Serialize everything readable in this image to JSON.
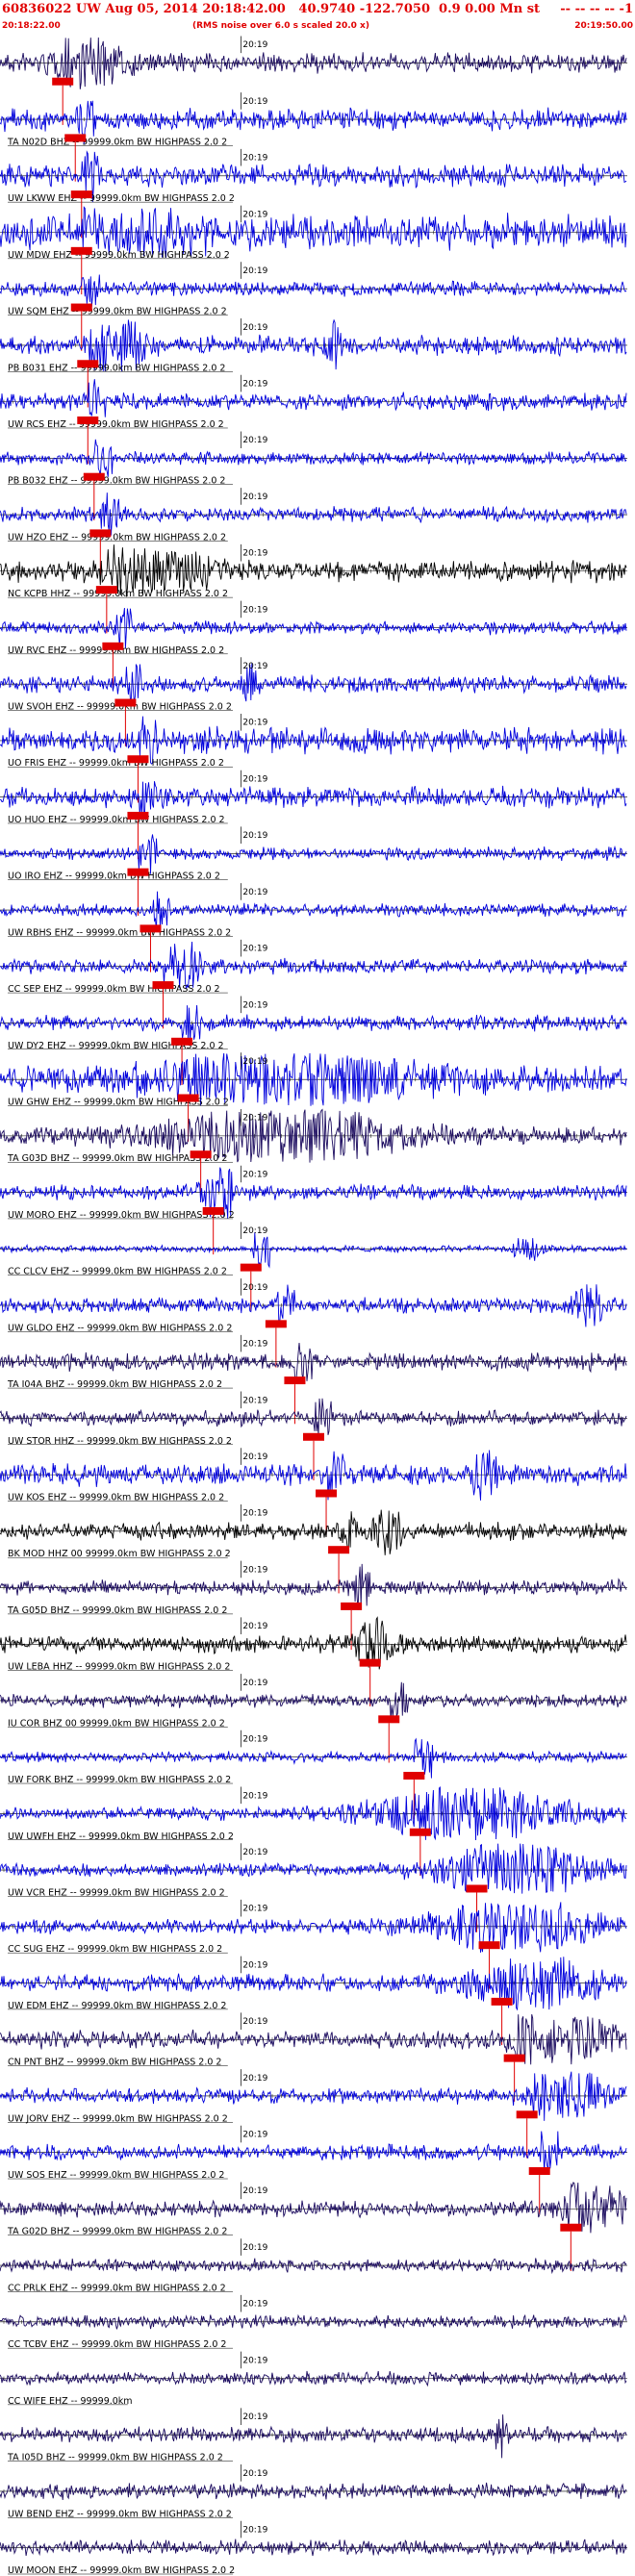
{
  "header": {
    "title": "60836022 UW Aug 05, 2014 20:18:42.00   40.9740 -122.7050  0.9 0.00 Mn st",
    "right_marker": "-- -- -- -- -1",
    "start_time": "20:18:22.00",
    "note": "(RMS noise over 6.0 s scaled 20.0 x)",
    "end_time": "20:19:50.00"
  },
  "chart_data": {
    "type": "seismogram",
    "time_window": [
      "20:18:22.00",
      "20:19:50.00"
    ],
    "minute_tick_label": "20:19",
    "traces": [
      {
        "label": "",
        "color": "#1a0a5e",
        "amp": 0.45,
        "pick": 0.1,
        "events": [
          [
            0.14,
            0.9,
            0.05
          ]
        ]
      },
      {
        "label": "TA N02D BHZ -- 99999.0km BW  HIGHPASS  2.0  2",
        "color": "#0000dd",
        "amp": 0.5,
        "pick": 0.12,
        "events": []
      },
      {
        "label": "UW LKWW EHZ -- 99999.0km BW  HIGHPASS  2.0  2",
        "color": "#0000dd",
        "amp": 0.5,
        "pick": 0.13,
        "events": []
      },
      {
        "label": "UW MDW EHZ -- 99999.0km BW  HIGHPASS  2.0  2",
        "color": "#0000dd",
        "amp": 0.8,
        "pick": 0.13,
        "events": [
          [
            0.25,
            1.0,
            0.06
          ]
        ]
      },
      {
        "label": "UW SQM EHZ -- 99999.0km BW  HIGHPASS  2.0  2",
        "color": "#0000dd",
        "amp": 0.35,
        "pick": 0.13,
        "events": []
      },
      {
        "label": "PB B031 EHZ -- 99999.0km BW  HIGHPASS  2.0  2",
        "color": "#0000dd",
        "amp": 0.45,
        "pick": 0.14,
        "events": [
          [
            0.2,
            1.0,
            0.03
          ],
          [
            0.53,
            0.9,
            0.01
          ]
        ]
      },
      {
        "label": "UW RCS EHZ -- 99999.0km BW  HIGHPASS  2.0  2",
        "color": "#0000dd",
        "amp": 0.4,
        "pick": 0.14,
        "events": []
      },
      {
        "label": "PB B032 EHZ -- 99999.0km BW  HIGHPASS  2.0  2",
        "color": "#0000dd",
        "amp": 0.3,
        "pick": 0.15,
        "events": []
      },
      {
        "label": "UW HZO EHZ -- 99999.0km BW  HIGHPASS  2.0  2",
        "color": "#0000dd",
        "amp": 0.35,
        "pick": 0.16,
        "events": []
      },
      {
        "label": "NC KCPB HHZ -- 99999.0km BW  HIGHPASS  2.0  2",
        "color": "#000000",
        "amp": 0.5,
        "pick": 0.17,
        "events": [
          [
            0.25,
            0.8,
            0.08
          ]
        ]
      },
      {
        "label": "UW RVC EHZ -- 99999.0km BW  HIGHPASS  2.0  2",
        "color": "#0000dd",
        "amp": 0.3,
        "pick": 0.18,
        "events": []
      },
      {
        "label": "UW SVOH EHZ -- 99999.0km BW  HIGHPASS  2.0  2",
        "color": "#0000dd",
        "amp": 0.4,
        "pick": 0.2,
        "events": [
          [
            0.4,
            0.8,
            0.01
          ]
        ]
      },
      {
        "label": "UO FRIS EHZ -- 99999.0km BW  HIGHPASS  2.0  2",
        "color": "#0000dd",
        "amp": 0.6,
        "pick": 0.22,
        "events": []
      },
      {
        "label": "UO HUO EHZ -- 99999.0km BW  HIGHPASS  2.0  2",
        "color": "#0000dd",
        "amp": 0.5,
        "pick": 0.22,
        "events": []
      },
      {
        "label": "UO IRO EHZ -- 99999.0km BW  HIGHPASS  2.0  2",
        "color": "#0000dd",
        "amp": 0.3,
        "pick": 0.22,
        "events": []
      },
      {
        "label": "UW RBHS EHZ -- 99999.0km BW  HIGHPASS  2.0  2",
        "color": "#0000dd",
        "amp": 0.3,
        "pick": 0.24,
        "events": []
      },
      {
        "label": "CC SEP EHZ -- 99999.0km BW  HIGHPASS  2.0  2",
        "color": "#0000dd",
        "amp": 0.35,
        "pick": 0.26,
        "events": [
          [
            0.3,
            0.7,
            0.02
          ]
        ]
      },
      {
        "label": "UW DY2 EHZ -- 99999.0km BW  HIGHPASS  2.0  2",
        "color": "#0000dd",
        "amp": 0.35,
        "pick": 0.29,
        "events": []
      },
      {
        "label": "UW GHW EHZ -- 99999.0km BW  HIGHPASS  2.0  2",
        "color": "#0000dd",
        "amp": 0.6,
        "pick": 0.3,
        "events": [
          [
            0.45,
            1.0,
            0.2
          ]
        ]
      },
      {
        "label": "TA G03D BHZ -- 99999.0km BW  HIGHPASS  2.0  2",
        "color": "#1a0a5e",
        "amp": 0.4,
        "pick": 0.32,
        "events": [
          [
            0.45,
            1.0,
            0.18
          ]
        ]
      },
      {
        "label": "UW MORO EHZ -- 99999.0km BW  HIGHPASS  2.0  2",
        "color": "#0000dd",
        "amp": 0.35,
        "pick": 0.34,
        "events": [
          [
            0.34,
            0.9,
            0.02
          ]
        ]
      },
      {
        "label": "CC CLCV EHZ -- 99999.0km BW  HIGHPASS  2.0  2",
        "color": "#0000dd",
        "amp": 0.15,
        "pick": 0.4,
        "events": [
          [
            0.84,
            0.6,
            0.02
          ]
        ]
      },
      {
        "label": "UW GLDO EHZ -- 99999.0km BW  HIGHPASS  2.0  2",
        "color": "#0000dd",
        "amp": 0.35,
        "pick": 0.44,
        "events": [
          [
            0.94,
            1.0,
            0.02
          ]
        ]
      },
      {
        "label": "TA I04A BHZ -- 99999.0km BW  HIGHPASS  2.0  2",
        "color": "#1a0a5e",
        "amp": 0.4,
        "pick": 0.47,
        "events": []
      },
      {
        "label": "UW STOR HHZ -- 99999.0km BW  HIGHPASS  2.0  2",
        "color": "#1a0a5e",
        "amp": 0.35,
        "pick": 0.5,
        "events": []
      },
      {
        "label": "UW KOS EHZ -- 99999.0km BW  HIGHPASS  2.0  2",
        "color": "#0000dd",
        "amp": 0.5,
        "pick": 0.52,
        "events": [
          [
            0.77,
            0.9,
            0.02
          ]
        ]
      },
      {
        "label": "BK MOD HHZ 00 99999.0km BW  HIGHPASS  2.0  2",
        "color": "#000000",
        "amp": 0.4,
        "pick": 0.54,
        "events": [
          [
            0.62,
            1.0,
            0.02
          ]
        ]
      },
      {
        "label": "TA G05D BHZ -- 99999.0km BW  HIGHPASS  2.0  2",
        "color": "#1a0a5e",
        "amp": 0.35,
        "pick": 0.56,
        "events": []
      },
      {
        "label": "UW LEBA HHZ -- 99999.0km BW  HIGHPASS  2.0  2",
        "color": "#000000",
        "amp": 0.4,
        "pick": 0.59,
        "events": [
          [
            0.6,
            0.8,
            0.03
          ]
        ]
      },
      {
        "label": "IU COR BHZ 00 99999.0km BW  HIGHPASS  2.0  2",
        "color": "#1a0a5e",
        "amp": 0.3,
        "pick": 0.62,
        "events": []
      },
      {
        "label": "UW FORK BHZ -- 99999.0km BW  HIGHPASS  2.0  2",
        "color": "#0000dd",
        "amp": 0.25,
        "pick": 0.66,
        "events": []
      },
      {
        "label": "UW UWFH EHZ -- 99999.0km BW  HIGHPASS  2.0  2",
        "color": "#0000dd",
        "amp": 0.3,
        "pick": 0.67,
        "events": [
          [
            0.75,
            1.0,
            0.15
          ]
        ]
      },
      {
        "label": "UW VCR EHZ -- 99999.0km BW  HIGHPASS  2.0  2",
        "color": "#0000dd",
        "amp": 0.3,
        "pick": 0.76,
        "events": [
          [
            0.82,
            1.0,
            0.12
          ]
        ]
      },
      {
        "label": "CC SUG EHZ -- 99999.0km BW  HIGHPASS  2.0  2",
        "color": "#0000dd",
        "amp": 0.35,
        "pick": 0.78,
        "events": [
          [
            0.82,
            1.0,
            0.12
          ]
        ]
      },
      {
        "label": "UW EDM EHZ -- 99999.0km BW  HIGHPASS  2.0  2",
        "color": "#0000dd",
        "amp": 0.4,
        "pick": 0.8,
        "events": [
          [
            0.85,
            0.9,
            0.1
          ]
        ]
      },
      {
        "label": "CN PNT BHZ -- 99999.0km BW  HIGHPASS  2.0  2",
        "color": "#1a0a5e",
        "amp": 0.4,
        "pick": 0.82,
        "events": [
          [
            0.9,
            0.8,
            0.08
          ]
        ]
      },
      {
        "label": "UW JORV EHZ -- 99999.0km BW  HIGHPASS  2.0  2",
        "color": "#0000dd",
        "amp": 0.35,
        "pick": 0.84,
        "events": [
          [
            0.92,
            0.8,
            0.06
          ]
        ]
      },
      {
        "label": "UW SOS EHZ -- 99999.0km BW  HIGHPASS  2.0  2",
        "color": "#0000dd",
        "amp": 0.35,
        "pick": 0.86,
        "events": []
      },
      {
        "label": "TA G02D BHZ -- 99999.0km BW  HIGHPASS  2.0  2",
        "color": "#1a0a5e",
        "amp": 0.35,
        "pick": 0.91,
        "events": [
          [
            0.95,
            1.0,
            0.05
          ]
        ]
      },
      {
        "label": "CC PRLK EHZ -- 99999.0km BW  HIGHPASS  2.0  2",
        "color": "#1a0a5e",
        "amp": 0.3,
        "pick": null,
        "events": []
      },
      {
        "label": "CC TCBV EHZ -- 99999.0km BW  HIGHPASS  2.0  2",
        "color": "#1a0a5e",
        "amp": 0.3,
        "pick": null,
        "events": []
      },
      {
        "label": "CC WIFE EHZ -- 99999.0km",
        "color": "#1a0a5e",
        "amp": 0.3,
        "pick": null,
        "events": []
      },
      {
        "label": "TA I05D BHZ -- 99999.0km BW  HIGHPASS  2.0  2",
        "color": "#1a0a5e",
        "amp": 0.35,
        "pick": null,
        "events": [
          [
            0.8,
            0.7,
            0.01
          ]
        ]
      },
      {
        "label": "UW BEND EHZ -- 99999.0km BW  HIGHPASS  2.0  2",
        "color": "#1a0a5e",
        "amp": 0.35,
        "pick": null,
        "events": []
      },
      {
        "label": "UW MOON EHZ -- 99999.0km BW  HIGHPASS  2.0  2",
        "color": "#1a0a5e",
        "amp": 0.35,
        "pick": null,
        "events": []
      }
    ]
  }
}
